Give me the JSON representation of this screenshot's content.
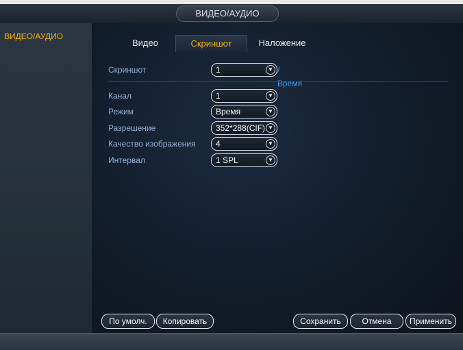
{
  "header": {
    "title": "ВИДЕО/АУДИО"
  },
  "sidebar": {
    "items": [
      {
        "label": "ВИДЕО/АУДИО"
      }
    ]
  },
  "tabs": [
    {
      "label": "Видео"
    },
    {
      "label": "Скриншот",
      "active": true
    },
    {
      "label": "Наложение"
    }
  ],
  "form": {
    "snapshot": {
      "label": "Скриншот",
      "value": "1",
      "suffix": "/Время"
    },
    "channel": {
      "label": "Канал",
      "value": "1"
    },
    "mode": {
      "label": "Режим",
      "value": "Время"
    },
    "resolution": {
      "label": "Разрешение",
      "value": "352*288(CIF)"
    },
    "quality": {
      "label": "Качество изображения",
      "value": "4"
    },
    "interval": {
      "label": "Интервал",
      "value": "1 SPL"
    }
  },
  "buttons": {
    "default": "По умолч.",
    "copy": "Копировать",
    "save": "Сохранить",
    "cancel": "Отмена",
    "apply": "Применить"
  },
  "colors": {
    "accent_active": "#f0b400",
    "label": "#8fb0d8",
    "link": "#2f9bff",
    "background": "#121c27"
  },
  "icons": {
    "dropdown": "chevron-down-icon"
  }
}
